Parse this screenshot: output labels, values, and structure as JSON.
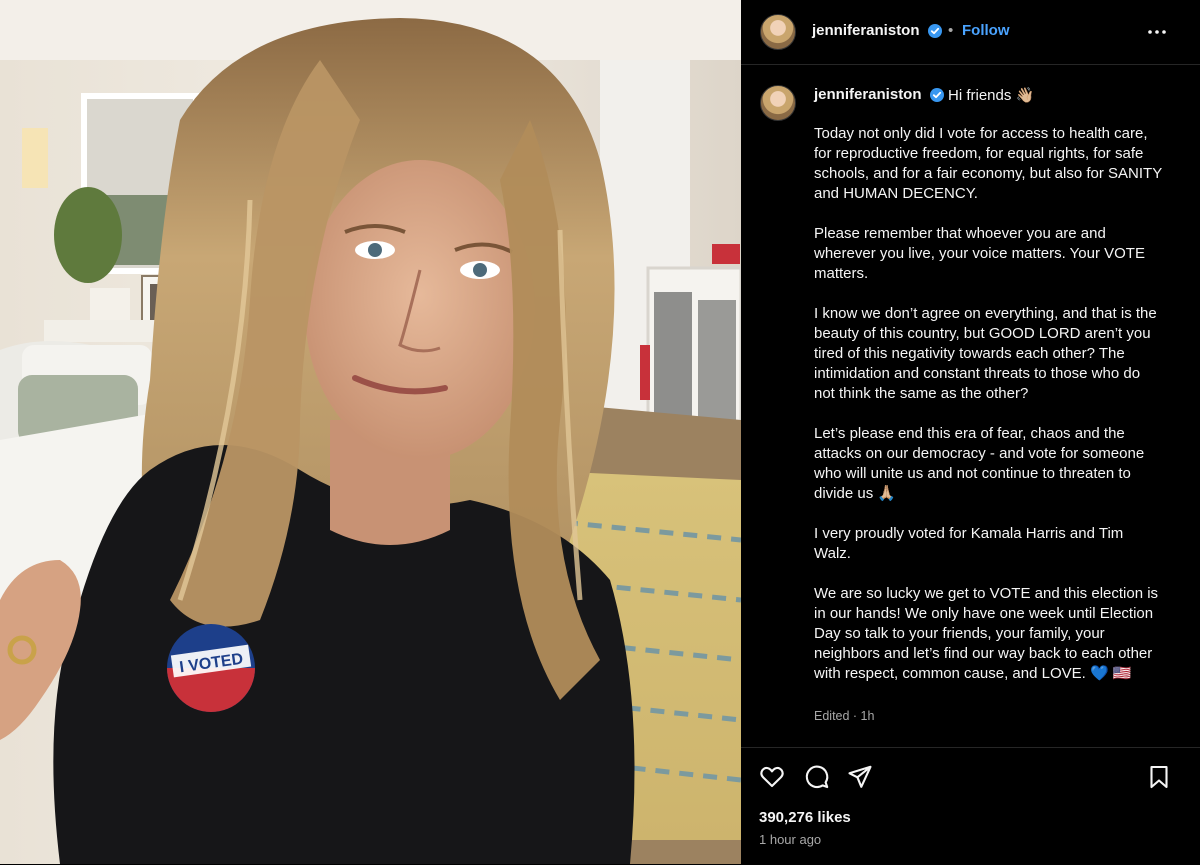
{
  "post": {
    "username": "jenniferaniston",
    "follow_label": "Follow",
    "separator": "•",
    "greeting": "Hi friends 👋🏼",
    "caption_paragraphs": [
      "Today not only did I vote for access to health care, for reproductive freedom, for equal rights, for safe schools, and for a fair economy, but also for SANITY and HUMAN DECENCY.",
      "Please remember that whoever you are and wherever you live, your voice matters. Your VOTE matters.",
      "I know we don’t agree on everything, and that is the beauty of this country, but GOOD LORD aren’t you tired of this negativity towards each other? The intimidation and constant threats to those who do not think the same as the other?",
      "Let’s please end this era of fear, chaos and the attacks on our democracy - and vote for someone who will unite us and not continue to threaten to divide us 🙏🏼",
      "I very proudly voted for Kamala Harris and Tim Walz.",
      "We are so lucky we get to VOTE and this election is in our hands! We only have one week until Election Day so talk to your friends, your family, your neighbors and let’s find our way back to each other with respect, common cause, and LOVE. 💙 🇺🇸"
    ],
    "edited_label": "Edited · 1h",
    "likes": "390,276 likes",
    "time_ago": "1 hour ago",
    "sticker_text": "I VOTED"
  },
  "icons": {
    "verified": "verified-badge-icon",
    "more": "more-options-icon",
    "like": "heart-icon",
    "comment": "comment-icon",
    "share": "share-icon",
    "save": "bookmark-icon"
  },
  "colors": {
    "background": "#000000",
    "accent": "#4aa3ff",
    "verified": "#3897f0",
    "muted": "#a8a8a8"
  }
}
